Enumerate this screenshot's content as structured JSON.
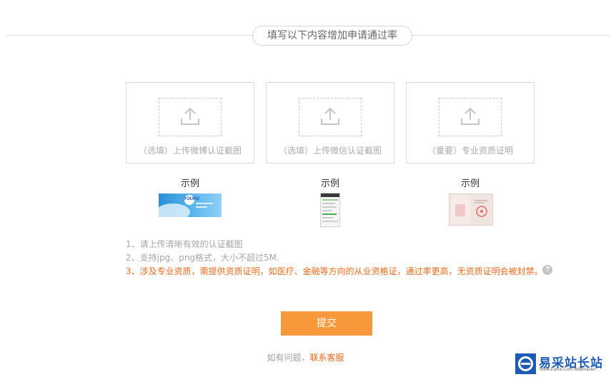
{
  "header": {
    "title": "填写以下内容增加申请通过率"
  },
  "uploads": [
    {
      "label": "（选填）上传微博认证截图"
    },
    {
      "label": "（选填）上传微信认证截图"
    },
    {
      "label": "（重要）专业资质证明"
    }
  ],
  "examples": {
    "label": "示例",
    "weibo_logo_text": "YOUKU"
  },
  "notes": {
    "line1": "1、请上传清晰有效的认证截图",
    "line2": "2、支持jpg、png格式，大小不超过5M.",
    "line3": "3、涉及专业资质，需提供资质证明，如医疗、金融等方向的从业资格证，通过率更高，无资质证明会被封禁。"
  },
  "help_icon_glyph": "?",
  "submit": {
    "label": "提交"
  },
  "footer": {
    "prefix": "如有问题，",
    "link": "联系客服"
  },
  "watermark": {
    "title": "易采站长站",
    "subtitle": "Www.Easck.Com  Webmaster"
  },
  "colors": {
    "accent": "#f7993b",
    "warning_text": "#ea6a1c",
    "muted_text": "#a5a5a5",
    "border": "#d9d9d9",
    "watermark_blue": "#1d5bb5"
  },
  "icons": {
    "upload": "upload-icon",
    "help": "question-icon",
    "watermark": "e-logo-icon"
  }
}
